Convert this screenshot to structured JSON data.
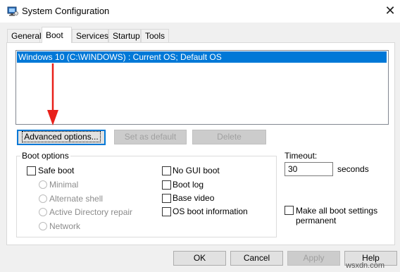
{
  "window": {
    "title": "System Configuration",
    "close_glyph": "✕"
  },
  "tabs": [
    {
      "label": "General"
    },
    {
      "label": "Boot"
    },
    {
      "label": "Services"
    },
    {
      "label": "Startup"
    },
    {
      "label": "Tools"
    }
  ],
  "active_tab": "Boot",
  "os_list": {
    "items": [
      "Windows 10 (C:\\WINDOWS) : Current OS; Default OS"
    ],
    "selected_index": 0
  },
  "buttons": {
    "advanced": "Advanced options...",
    "set_default": "Set as default",
    "delete": "Delete"
  },
  "boot_options": {
    "title": "Boot options",
    "safe_boot": "Safe boot",
    "minimal": "Minimal",
    "alternate_shell": "Alternate shell",
    "active_directory_repair": "Active Directory repair",
    "network": "Network",
    "no_gui_boot": "No GUI boot",
    "boot_log": "Boot log",
    "base_video": "Base video",
    "os_boot_information": "OS boot information"
  },
  "timeout": {
    "label": "Timeout:",
    "value": "30",
    "unit": "seconds"
  },
  "make_permanent": {
    "line1": "Make all boot settings",
    "line2": "permanent"
  },
  "dialog_buttons": {
    "ok": "OK",
    "cancel": "Cancel",
    "apply": "Apply",
    "help": "Help"
  },
  "watermark": "wsxdn.com",
  "colors": {
    "selection": "#0078d7",
    "arrow": "#e8201a"
  }
}
